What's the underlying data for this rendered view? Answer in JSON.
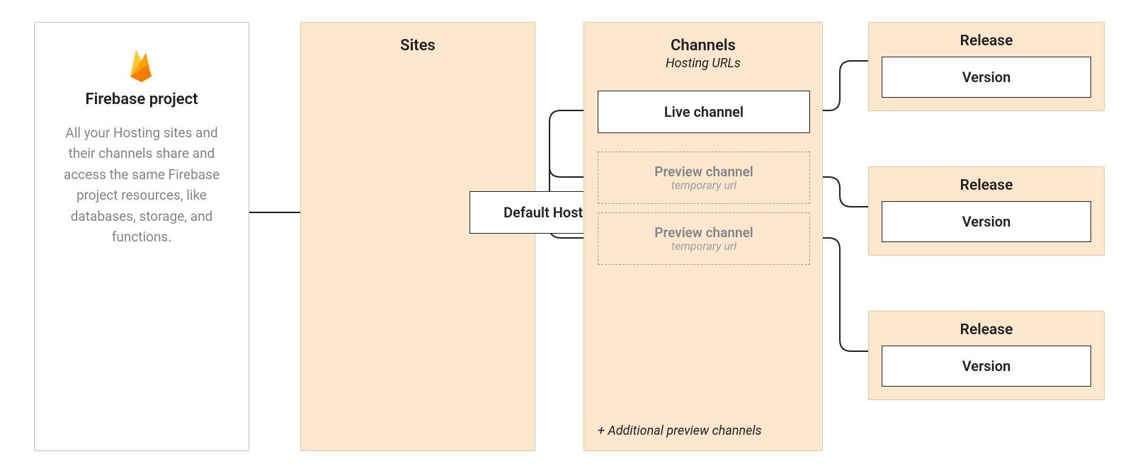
{
  "project": {
    "title": "Firebase project",
    "description": "All your Hosting sites and their channels share and access the same Firebase project resources, like databases, storage, and functions."
  },
  "sites": {
    "title": "Sites",
    "default_site": "Default Hosting site"
  },
  "channels": {
    "title": "Channels",
    "subtitle": "Hosting URLs",
    "live": "Live channel",
    "preview_label": "Preview channel",
    "preview_sub": "temporary url",
    "more": "+ Additional preview channels"
  },
  "release": {
    "title": "Release",
    "version": "Version"
  },
  "icons": {
    "firebase": "firebase-logo-icon"
  },
  "colors": {
    "peach": "#fde7cd",
    "ink": "#202124",
    "muted": "#80868b"
  }
}
